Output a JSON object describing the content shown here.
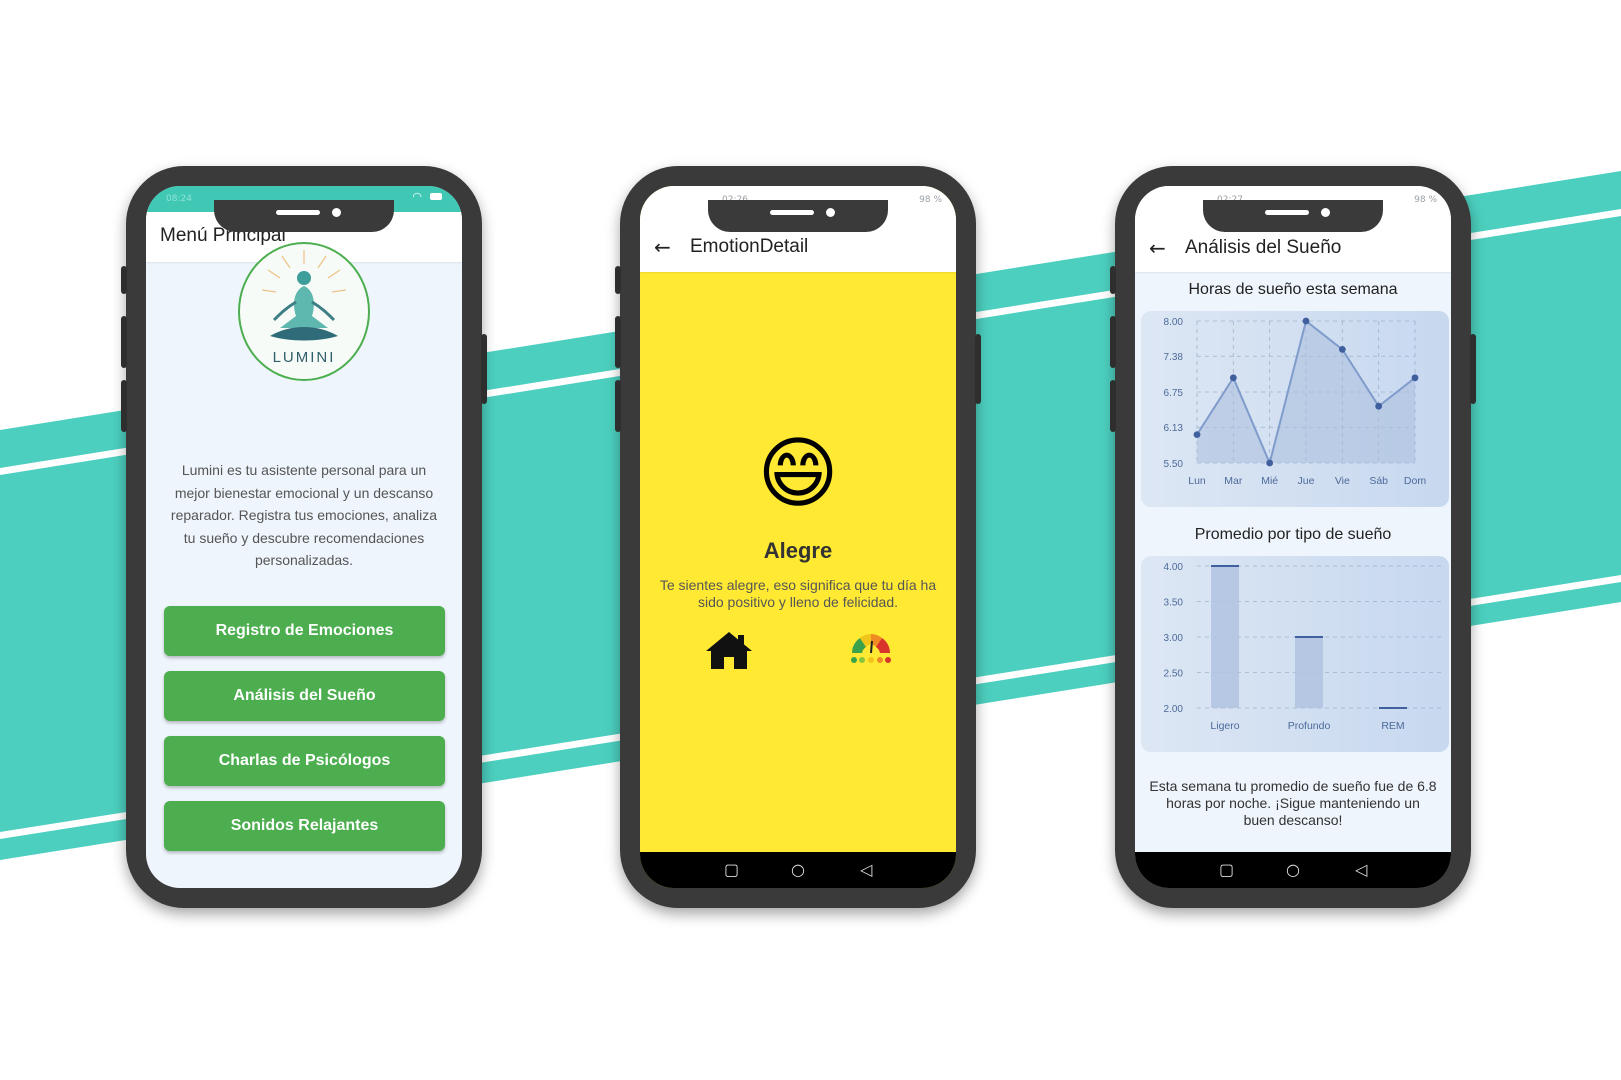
{
  "phone1": {
    "status_time": "08:24",
    "header_title": "Menú Principal",
    "logo_text": "LUMINI",
    "description": "Lumini es tu asistente personal para un mejor bienestar emocional y un descanso reparador. Registra tus emociones, analiza tu sueño y descubre recomendaciones personalizadas.",
    "buttons": [
      "Registro de Emociones",
      "Análisis del Sueño",
      "Charlas de Psicólogos",
      "Sonidos Relajantes"
    ],
    "colors": {
      "accent": "#4cae4f",
      "statusbar": "#40c8b5"
    }
  },
  "phone2": {
    "status_time": "02:26",
    "battery": "98 %",
    "header_title": "EmotionDetail",
    "back_icon": "arrow-left-icon",
    "emoji": "😄",
    "emotion_name": "Alegre",
    "emotion_text": "Te sientes alegre, eso significa que tu día ha sido positivo y lleno de felicidad.",
    "home_icon": "home-icon",
    "mood_icon": "mood-meter-icon",
    "colors": {
      "background": "#ffe932"
    }
  },
  "phone3": {
    "status_time": "02:27",
    "battery": "98 %",
    "header_title": "Análisis del Sueño",
    "back_icon": "arrow-left-icon",
    "summary": "Esta semana tu promedio de sueño fue de 6.8 horas por noche. ¡Sigue manteniendo un buen descanso!"
  },
  "chart_data": [
    {
      "type": "line",
      "title": "Horas de sueño esta semana",
      "categories": [
        "Lun",
        "Mar",
        "Mié",
        "Jue",
        "Vie",
        "Sáb",
        "Dom"
      ],
      "values": [
        6.0,
        7.0,
        5.5,
        8.0,
        7.5,
        6.5,
        7.0
      ],
      "yticks": [
        "5.50",
        "6.13",
        "6.75",
        "7.38",
        "8.00"
      ],
      "ylim": [
        5.5,
        8.0
      ],
      "grid": true
    },
    {
      "type": "bar",
      "title": "Promedio por tipo de sueño",
      "categories": [
        "Ligero",
        "Profundo",
        "REM"
      ],
      "values": [
        4.0,
        3.0,
        2.0
      ],
      "yticks": [
        "2.00",
        "2.50",
        "3.00",
        "3.50",
        "4.00"
      ],
      "ylim": [
        2.0,
        4.0
      ],
      "grid": true
    }
  ],
  "nav_icons": [
    "square-icon",
    "circle-icon",
    "triangle-back-icon"
  ],
  "colors": {
    "band": "#4ccfbe",
    "phone_frame": "#3a3a3a",
    "chart_series": "#3f5f9f"
  }
}
